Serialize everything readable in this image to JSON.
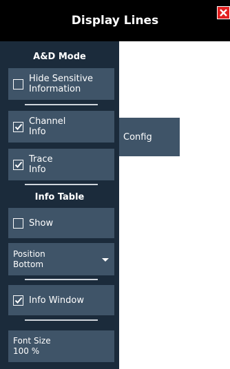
{
  "header": {
    "title": "Display Lines"
  },
  "sections": {
    "ad_mode": "A&D Mode",
    "info_table": "Info Table"
  },
  "buttons": {
    "hide_sensitive": {
      "label": "Hide Sensitive\nInformation",
      "checked": false
    },
    "channel_info": {
      "label": "Channel\nInfo",
      "checked": true
    },
    "trace_info": {
      "label": "Trace\nInfo",
      "checked": true
    },
    "show": {
      "label": "Show",
      "checked": false
    },
    "position": {
      "label": "Position",
      "value": "Bottom"
    },
    "info_window": {
      "label": "Info Window",
      "checked": true
    },
    "font_size": {
      "label": "Font Size",
      "value": "100 %"
    }
  },
  "config": {
    "label": "Config"
  },
  "colors": {
    "panel": "#1b2b3b",
    "button": "#3f5468",
    "close": "#e21f1f",
    "header": "#000000"
  },
  "icons": {
    "close": "close-icon",
    "check": "checkmark-icon",
    "dropdown": "chevron-down-icon"
  }
}
